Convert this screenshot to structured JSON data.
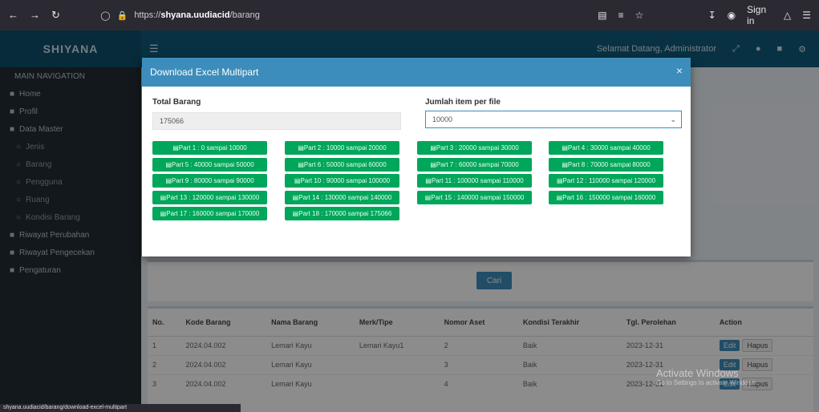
{
  "browser": {
    "url_prefix": "https://",
    "url_domain": "shyana.uudiacid",
    "url_path": "/barang",
    "signin_label": "Sign in"
  },
  "app": {
    "brand": "SHIYANA",
    "header_right": "Selamat Datang, Administrator"
  },
  "sidebar": {
    "items": [
      {
        "label": "MAIN NAVIGATION",
        "sub": false
      },
      {
        "label": "Home",
        "sub": false
      },
      {
        "label": "Profil",
        "sub": false
      },
      {
        "label": "Data Master",
        "sub": false
      },
      {
        "label": "Jenis",
        "sub": true
      },
      {
        "label": "Barang",
        "sub": true
      },
      {
        "label": "Pengguna",
        "sub": true
      },
      {
        "label": "Ruang",
        "sub": true
      },
      {
        "label": "Kondisi Barang",
        "sub": true
      },
      {
        "label": "Riwayat Perubahan",
        "sub": false
      },
      {
        "label": "Riwayat Pengecekan",
        "sub": false
      },
      {
        "label": "Pengaturan",
        "sub": false
      }
    ]
  },
  "filter": {
    "button_label": "Cari"
  },
  "modal": {
    "title": "Download Excel Multipart",
    "total_label": "Total Barang",
    "total_value": "175066",
    "per_file_label": "Jumlah item per file",
    "per_file_value": "10000",
    "parts": [
      "Part 1 : 0 sampai 10000",
      "Part 2 : 10000 sampai 20000",
      "Part 3 : 20000 sampai 30000",
      "Part 4 : 30000 sampai 40000",
      "Part 5 : 40000 sampai 50000",
      "Part 6 : 50000 sampai 60000",
      "Part 7 : 60000 sampai 70000",
      "Part 8 : 70000 sampai 80000",
      "Part 9 : 80000 sampai 90000",
      "Part 10 : 90000 sampai 100000",
      "Part 11 : 100000 sampai 110000",
      "Part 12 : 110000 sampai 120000",
      "Part 13 : 120000 sampai 130000",
      "Part 14 : 130000 sampai 140000",
      "Part 15 : 140000 sampai 150000",
      "Part 16 : 150000 sampai 160000",
      "Part 17 : 160000 sampai 170000",
      "Part 18 : 170000 sampai 175066"
    ]
  },
  "table": {
    "columns": [
      "No.",
      "Kode Barang",
      "Nama Barang",
      "Merk/Tipe",
      "Nomor Aset",
      "Kondisi Terakhir",
      "Tgl. Perolehan",
      "Action"
    ],
    "rows": [
      [
        "1",
        "2024.04.002",
        "Lemari Kayu",
        "Lemari Kayu1",
        "2",
        "Baik",
        "2023-12-31"
      ],
      [
        "2",
        "2024.04.002",
        "Lemari Kayu",
        "",
        "3",
        "Baik",
        "2023-12-31"
      ],
      [
        "3",
        "2024.04.002",
        "Lemari Kayu",
        "",
        "4",
        "Baik",
        "2023-12-31"
      ]
    ],
    "edit_label": "Edit",
    "delete_label": "Hapus"
  },
  "watermark": {
    "title": "Activate Windows",
    "subtitle": "Go to Settings to activate Windows."
  },
  "status_url": "shyana.uudiacid/barang/download-excel-multipart"
}
